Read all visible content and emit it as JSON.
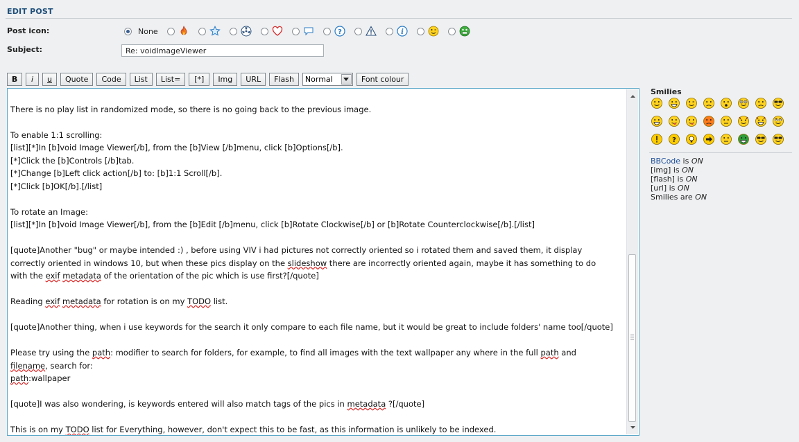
{
  "section_title": "EDIT POST",
  "post_icon": {
    "label": "Post icon:",
    "selected": "None",
    "options": [
      {
        "name": "none",
        "text": "None",
        "checked": true
      },
      {
        "name": "fire-icon"
      },
      {
        "name": "star-icon"
      },
      {
        "name": "radioactive-icon"
      },
      {
        "name": "heart-icon"
      },
      {
        "name": "speech-bubble-icon"
      },
      {
        "name": "question-icon"
      },
      {
        "name": "warning-icon"
      },
      {
        "name": "info-icon"
      },
      {
        "name": "wink-smiley-icon"
      },
      {
        "name": "grin-smiley-icon"
      }
    ]
  },
  "subject": {
    "label": "Subject:",
    "value": "Re: voidImageViewer"
  },
  "toolbar": {
    "bold": "B",
    "italic": "i",
    "underline": "u",
    "quote": "Quote",
    "code": "Code",
    "list": "List",
    "list_eq": "List=",
    "list_item": "[*]",
    "img": "Img",
    "url": "URL",
    "flash": "Flash",
    "font_size": "Normal",
    "font_colour": "Font colour"
  },
  "editor": {
    "lines": [
      "",
      "There is no play list in randomized mode, so there is no going back to the previous image.",
      "",
      "To enable 1:1 scrolling:",
      "[list][*]In [b]void Image Viewer[/b], from the [b]View [/b]menu, click [b]Options[/b].",
      "[*]Click the [b]Controls [/b]tab.",
      "[*]Change [b]Left click action[/b] to: [b]1:1 Scroll[/b].",
      "[*]Click [b]OK[/b].[/list]",
      "",
      "To rotate an Image:",
      "[list][*]In [b]void Image Viewer[/b], from the [b]Edit [/b]menu, click [b]Rotate Clockwise[/b] or [b]Rotate Counterclockwise[/b].[/list]",
      "",
      "[quote]Another \"bug\" or maybe intended :) , before using VIV i had pictures not correctly oriented so i rotated them and saved them, it display",
      "correctly oriented in windows 10, but when these pics display on the slideshow there are incorrectly oriented again, maybe it has something to do",
      "with the exif metadata of the orientation of the pic which is use first?[/quote]",
      "",
      "Reading exif metadata for rotation is on my TODO list.",
      "",
      "[quote]Another thing, when i use keywords for the search it only compare to each file name, but it would be great to include folders' name too[/quote]",
      "",
      "Please try using the path: modifier to search for folders, for example, to find all images with the text wallpaper any where in the full path and",
      "filename, search for:",
      "path:wallpaper",
      "",
      "[quote]I was also wondering, is keywords entered will also match tags of the pics in metadata ?[/quote]",
      "",
      "This is on my TODO list for Everything, however, don't expect this to be fast, as this information is unlikely to be indexed."
    ],
    "spellcheck_words": [
      "slideshow",
      "exif",
      "metadata",
      "TODO",
      "filename",
      "path"
    ]
  },
  "smilies": {
    "title": "Smilies",
    "items": [
      "smile-icon",
      "laugh-icon",
      "wink-icon",
      "sad-icon",
      "surprised-icon",
      "eek-icon",
      "confused-icon",
      "cool-icon",
      "grin-icon",
      "razz-icon",
      "tongue-icon",
      "mad-icon",
      "neutral-icon",
      "evil-icon",
      "twisted-icon",
      "roll-eyes-icon",
      "exclaim-icon",
      "question-icon",
      "idea-icon",
      "arrow-icon",
      "neutral2-icon",
      "green-icon",
      "geek-icon",
      "uber-geek-icon"
    ]
  },
  "status": {
    "bbcode_link": "BBCode",
    "bbcode_is": " is ",
    "bbcode_state": "ON",
    "img": "[img] is ",
    "img_state": "ON",
    "flash": "[flash] is ",
    "flash_state": "ON",
    "url": "[url] is ",
    "url_state": "ON",
    "smilies": "Smilies are ",
    "smilies_state": "ON"
  },
  "colors": {
    "title": "#1f4f7a",
    "editor_border": "#5aa7c8",
    "link": "#1f4f9a"
  }
}
